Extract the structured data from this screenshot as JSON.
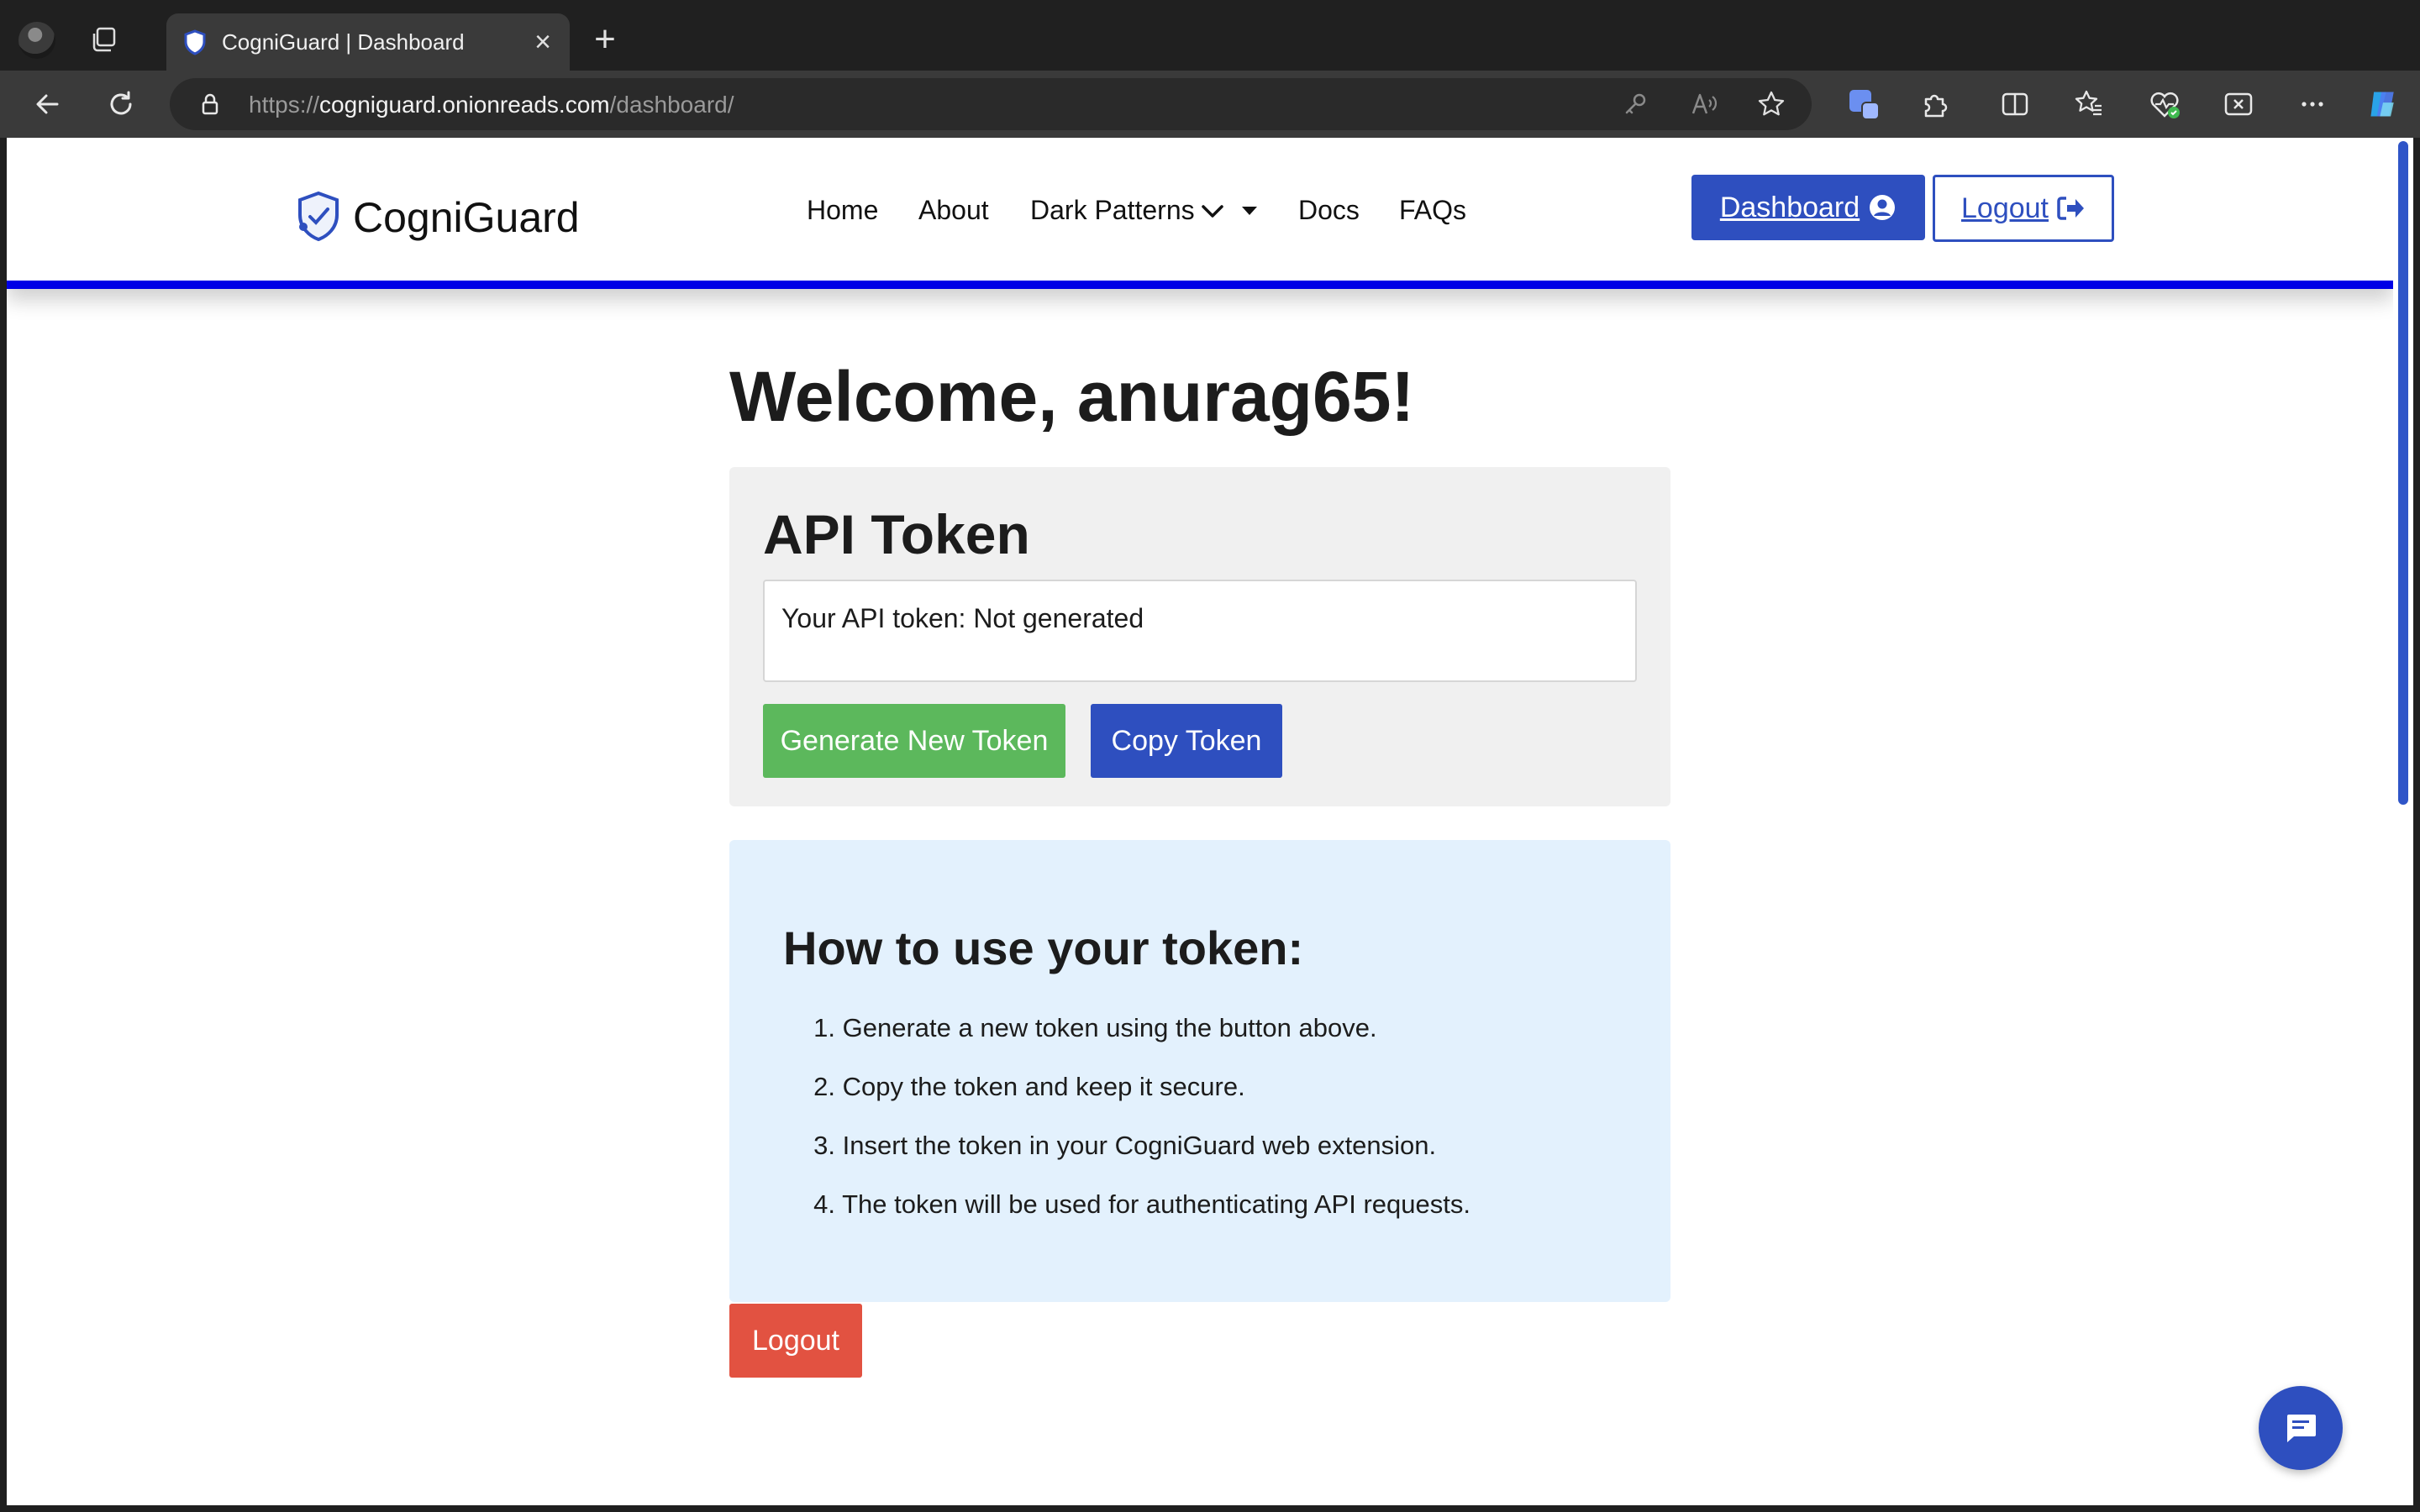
{
  "browser": {
    "tab_title": "CogniGuard | Dashboard",
    "url_scheme": "https://",
    "url_host": "cogniguard.onionreads.com",
    "url_path": "/dashboard/"
  },
  "navbar": {
    "brand": "CogniGuard",
    "links": [
      "Home",
      "About",
      "Dark Patterns",
      "Docs",
      "FAQs"
    ],
    "dashboard_button": "Dashboard",
    "logout_button": "Logout"
  },
  "main": {
    "welcome": "Welcome, anurag65!",
    "token_card": {
      "title": "API Token",
      "token_text": "Your API token: Not generated",
      "generate_button": "Generate New Token",
      "copy_button": "Copy Token"
    },
    "info_card": {
      "title": "How to use your token:",
      "steps": [
        {
          "num": "1.",
          "text": "Generate a new token using the button above."
        },
        {
          "num": "2.",
          "text": "Copy the token and keep it secure."
        },
        {
          "num": "3.",
          "text": "Insert the token in your CogniGuard web extension."
        },
        {
          "num": "4.",
          "text": "The token will be used for authenticating API requests."
        }
      ]
    },
    "logout_button": "Logout"
  },
  "colors": {
    "brand_blue": "#2e4fbf",
    "nav_underline": "#0000e6",
    "generate_green": "#5cb85c",
    "logout_red": "#e25241",
    "info_bg": "#e3f1fd"
  },
  "icons": [
    "back-icon",
    "reload-icon",
    "lock-icon",
    "key-icon",
    "read-aloud-icon",
    "star-icon",
    "extensions-icon",
    "split-screen-icon",
    "favorites-icon",
    "browser-essentials-icon",
    "screenshot-icon",
    "more-icon",
    "copilot-icon",
    "user-circle-icon",
    "sign-out-icon",
    "chat-icon"
  ]
}
